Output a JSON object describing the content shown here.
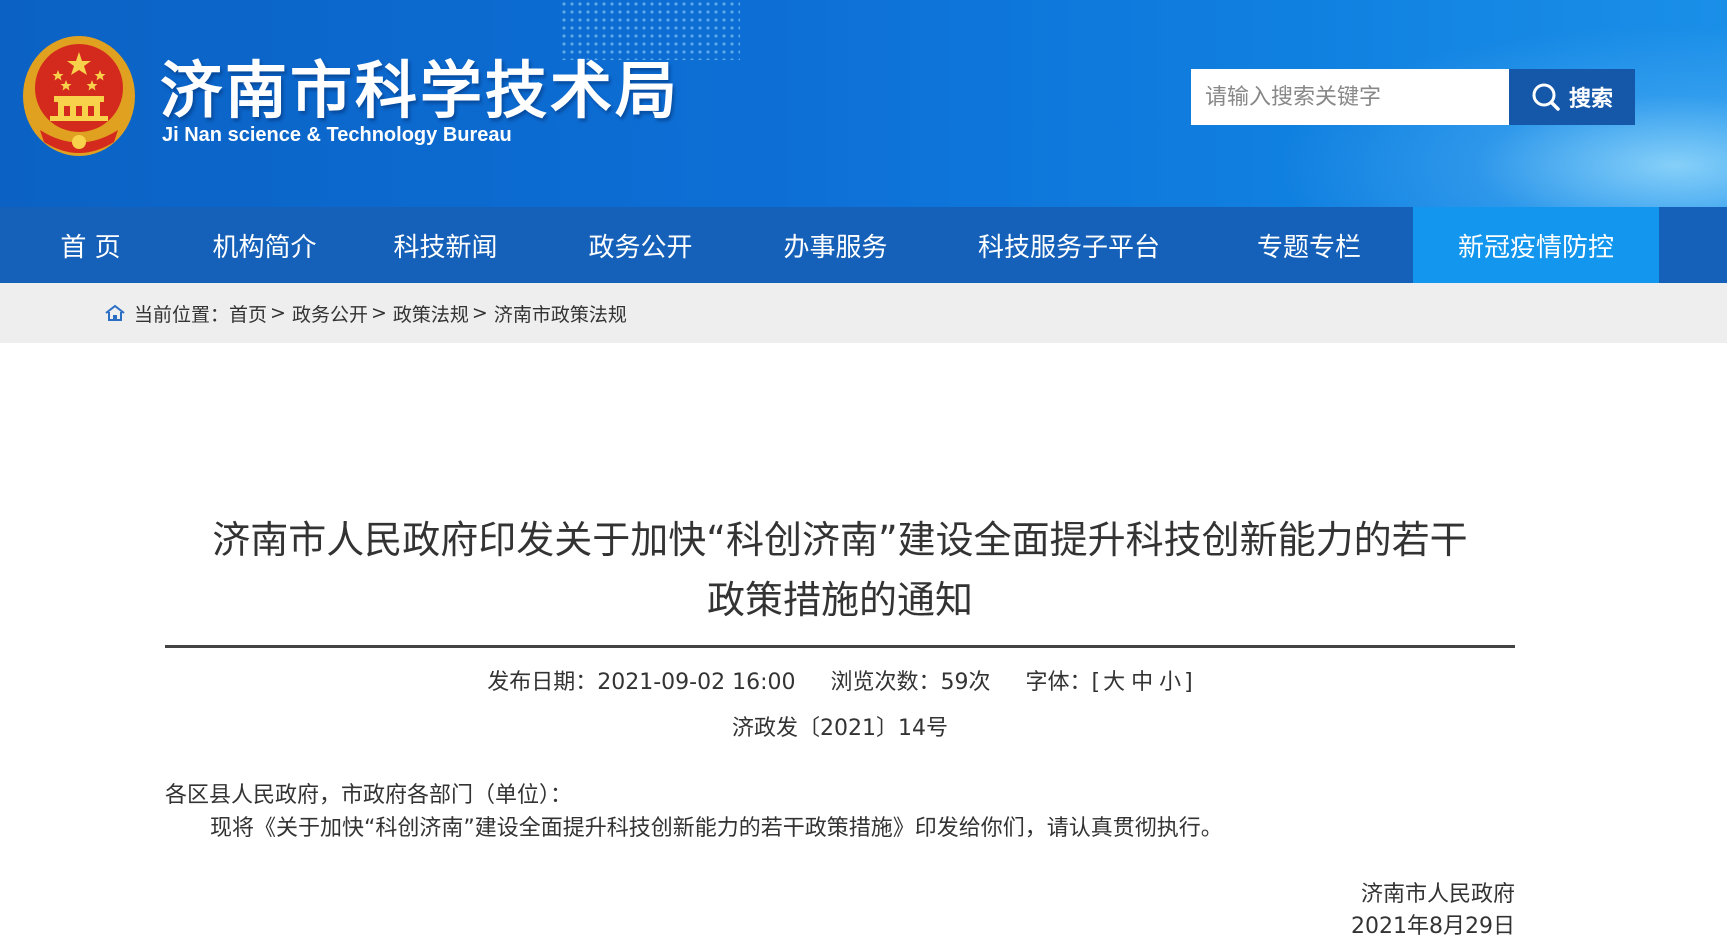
{
  "header": {
    "title": "济南市科学技术局",
    "subtitle": "Ji Nan science & Technology Bureau",
    "search_placeholder": "请输入搜索关键字",
    "search_label": "搜索"
  },
  "nav": {
    "items": [
      {
        "label": "首 页"
      },
      {
        "label": "机构简介"
      },
      {
        "label": "科技新闻"
      },
      {
        "label": "政务公开"
      },
      {
        "label": "办事服务"
      },
      {
        "label": "科技服务子平台"
      },
      {
        "label": "专题专栏"
      },
      {
        "label": "新冠疫情防控"
      }
    ]
  },
  "breadcrumb": {
    "prefix": "当前位置：",
    "items": [
      "首页",
      "政务公开",
      "政策法规",
      "济南市政策法规"
    ],
    "separator": ">"
  },
  "article": {
    "title_line1": "济南市人民政府印发关于加快“科创济南”建设全面提升科技创新能力的若干",
    "title_line2": "政策措施的通知",
    "publish": "发布日期：2021-09-02 16:00",
    "views": "浏览次数：59次",
    "font_label": "字体：[",
    "font_large": "大",
    "font_medium": "中",
    "font_small": "小",
    "font_end": "]",
    "doc_number": "济政发〔2021〕14号",
    "salutation": "各区县人民政府，市政府各部门（单位）：",
    "body": "现将《关于加快“科创济南”建设全面提升科技创新能力的若干政策措施》印发给你们，请认真贯彻执行。",
    "signature": "济南市人民政府",
    "date": "2021年8月29日"
  },
  "colors": {
    "header_blue": "#0d6fd6",
    "nav_blue": "#1560b8",
    "nav_active": "#1296ee",
    "search_button": "#1557a8",
    "breadcrumb_bg": "#eeeeee"
  }
}
